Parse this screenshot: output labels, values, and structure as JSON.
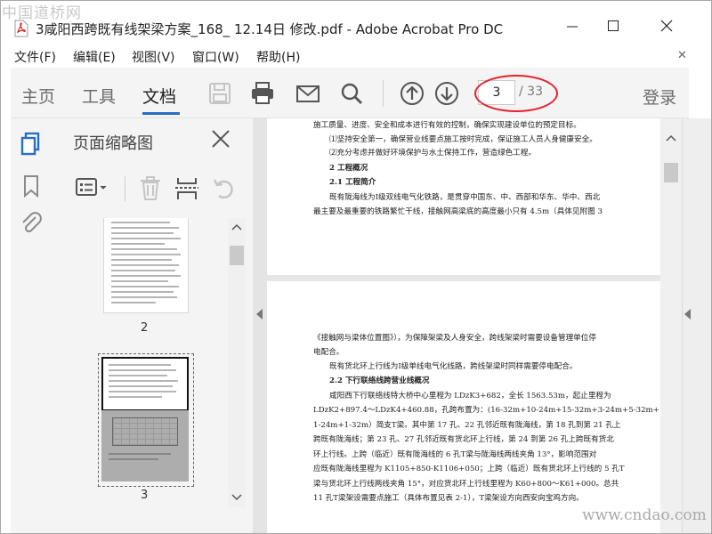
{
  "window": {
    "title": "3咸阳西跨既有线架梁方案_168_ 12.14日 修改.pdf - Adobe Acrobat Pro DC",
    "watermark_top": "中国道桥网",
    "watermark_bottom": "www.cndao.com"
  },
  "menu": [
    "文件(F)",
    "编辑(E)",
    "视图(V)",
    "窗口(W)",
    "帮助(H)"
  ],
  "toolbar": {
    "tabs": [
      "主页",
      "工具",
      "文档"
    ],
    "active_tab": "文档",
    "page_current": "3",
    "page_total": "/ 33",
    "login_label": "登录"
  },
  "thumbnails": {
    "title": "页面缩略图",
    "pages": [
      {
        "number": "2"
      },
      {
        "number": "3",
        "selected": true
      }
    ]
  },
  "document": {
    "page_a_lines": [
      "施工质量、进度、安全和成本进行有效的控制，确保实现建设单位的预定目标。",
      "⑴坚持安全第一，确保营业线要点施工按时完成，保证施工人员人身健康安全。",
      "⑵充分考虑并做好环境保护与水土保持工作，营造绿色工程。",
      "2 工程概况",
      "2.1 工程简介",
      "既有陇海线为Ⅰ级双线电气化铁路，是贯穿中国东、中、西部和华东、华中、西北",
      "最主要及最重要的铁路繁忙干线，接触网高梁底的高度最小只有 4.5m（具体见附图 3"
    ],
    "page_b_lines": [
      "《接触网与梁体位置图》），为保障架梁及人身安全，跨线架梁时需要设备管理单位停",
      "电配合。",
      "既有货北环上行线为Ⅰ级单线电气化线路，跨线架梁时同样需要停电配合。",
      "2.2 下行联络线跨营业线概况",
      "咸阳西下行联络线特大桥中心里程为 LDzK3+682，全长 1563.53m，起止里程为",
      "LDzK2+897.4～LDzK4+460.88，孔跨布置为：(16-32m+10-24m+15-32m+3-24m+5-32m+",
      "1-24m+1-32m）简支T梁。其中第 17 孔、22 孔邻近既有陇海线，第 18 孔到第 21 孔上",
      "跨既有陇海线；第 23 孔、27 孔邻近既有货北环上行线，第 24 到第 26 孔上跨既有货北",
      "环上行线。上跨（临近）既有陇海线的 6 孔T梁与陇海线两线夹角 13°，影响范围对",
      "应既有陇海线里程为 K1105+850-K1106+050；上跨（临近）既有货北环上行线的 5 孔T",
      "梁与货北环上行线两线夹角 15°，对应货北环上行线里程为 K60+800～K61+000。总共",
      "11 孔T梁架设需要点施工（具体布置见表 2-1），T梁架设方向西安向宝鸡方向。"
    ]
  }
}
